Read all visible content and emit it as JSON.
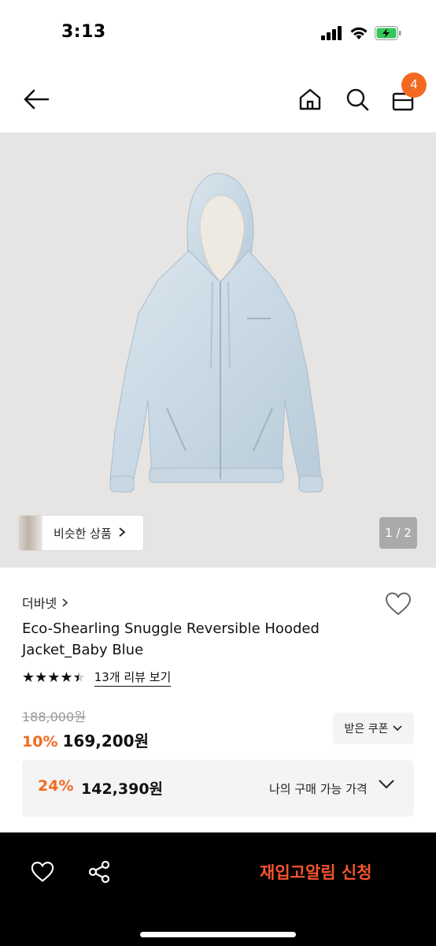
{
  "status_bar": {
    "time": "3:13"
  },
  "nav": {
    "cart_count": "4"
  },
  "hero": {
    "similar_label": "비슷한 상품",
    "page_counter": "1 / 2"
  },
  "product": {
    "brand": "더바넷",
    "title": "Eco-Shearling Snuggle Reversible Hooded Jacket_Baby Blue",
    "rating": 4.5,
    "review_link": "13개 리뷰 보기",
    "original_price": "188,000원",
    "discount": "10%",
    "price": "169,200원",
    "coupon_label": "받은 쿠폰",
    "my_discount": "24%",
    "my_price": "142,390원",
    "my_price_label": "나의 구매 가능 가격"
  },
  "bottom_bar": {
    "restock_label": "재입고알림 신청"
  },
  "colors": {
    "accent": "#f26a21",
    "restock": "#f2542d",
    "hero_bg": "#e6e5e3",
    "jacket": "#cfdde8"
  },
  "icons": [
    "back-arrow-icon",
    "home-icon",
    "search-icon",
    "cart-icon",
    "heart-icon",
    "share-icon",
    "chevron-right-icon",
    "chevron-down-icon",
    "star-icon"
  ]
}
